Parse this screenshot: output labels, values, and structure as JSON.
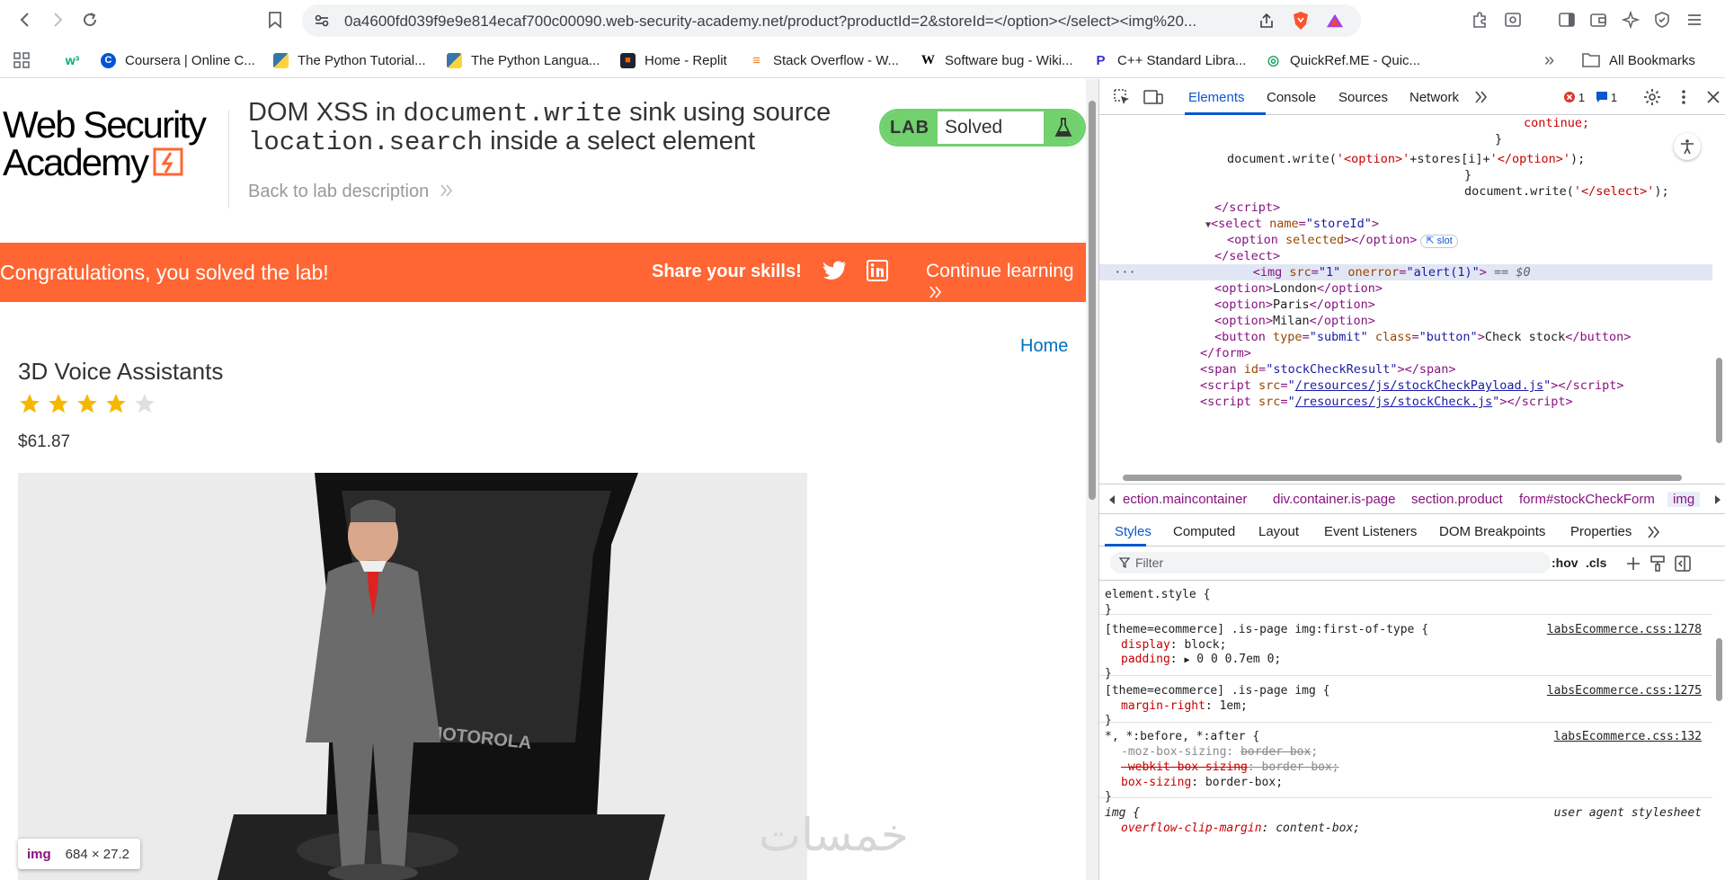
{
  "browser": {
    "url": "0a4600fd039f9e9e814ecaf700c00090.web-security-academy.net/product?productId=2&storeId=</option></select><img%20...",
    "bookmarks": [
      {
        "label": "Coursera | Online C..."
      },
      {
        "label": "The Python Tutorial..."
      },
      {
        "label": "The Python Langua..."
      },
      {
        "label": "Home - Replit"
      },
      {
        "label": "Stack Overflow - W..."
      },
      {
        "label": "Software bug - Wiki..."
      },
      {
        "label": "C++ Standard Libra..."
      },
      {
        "label": "QuickRef.ME - Quic..."
      }
    ],
    "all_bookmarks": "All Bookmarks",
    "overflow": "»"
  },
  "page": {
    "logo_line1": "Web Security",
    "logo_line2": "Academy",
    "lab_title_1": "DOM XSS in ",
    "lab_title_code1": "document.write",
    "lab_title_2": " sink using source",
    "lab_title_code2": "location.search",
    "lab_title_3": " inside a select element",
    "back_link": "Back to lab description",
    "lab_label": "LAB",
    "lab_status": "Solved",
    "banner_msg": "Congratulations, you solved the lab!",
    "share": "Share your skills!",
    "continue": "Continue learning",
    "home": "Home",
    "product_title": "3D Voice Assistants",
    "rating": 4,
    "rating_max": 5,
    "price": "$61.87",
    "tooltip_tag": "img",
    "tooltip_dims": "684 × 27.2",
    "watermark": "خمسات"
  },
  "devtools": {
    "tabs": [
      "Elements",
      "Console",
      "Sources",
      "Network"
    ],
    "error_count": "1",
    "message_count": "1",
    "breadcrumbs": [
      "ection.maincontainer",
      "div.container.is-page",
      "section.product",
      "form#stockCheckForm",
      "img"
    ],
    "style_tabs": [
      "Styles",
      "Computed",
      "Layout",
      "Event Listeners",
      "DOM Breakpoints",
      "Properties"
    ],
    "filter_placeholder": "Filter",
    "hov": ":hov",
    "cls": ".cls",
    "colors": {
      "accent": "#0b57d0",
      "tag": "#881280",
      "attr": "#994500",
      "value": "#1a1aa6"
    }
  }
}
